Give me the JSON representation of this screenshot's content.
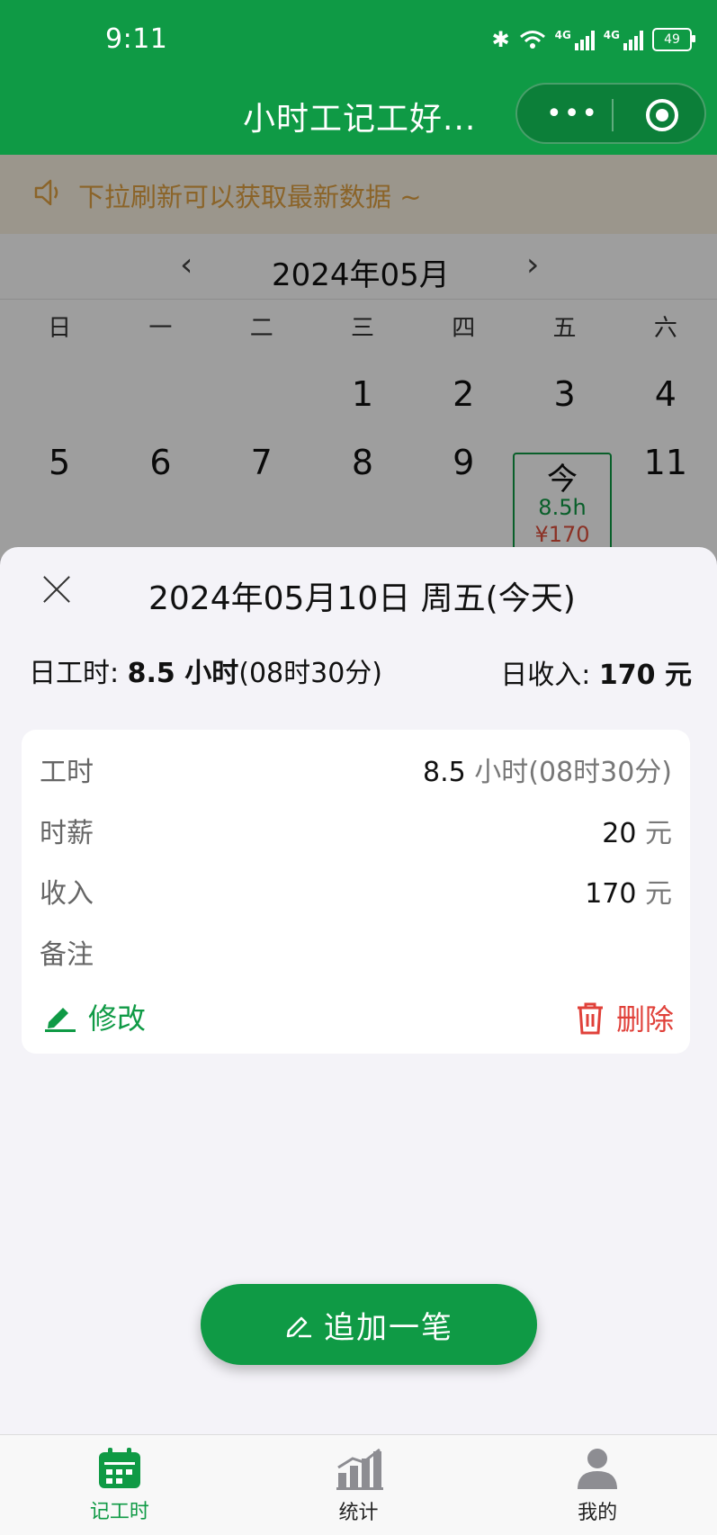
{
  "status_bar": {
    "time": "9:11",
    "network": "4G",
    "battery": "49"
  },
  "nav": {
    "title": "小时工记工好...",
    "more_label": "•••"
  },
  "notice": {
    "text": "下拉刷新可以获取最新数据 ~"
  },
  "calendar": {
    "month_title": "2024年05月",
    "prev_label": "‹",
    "next_label": "›",
    "weekdays": [
      "日",
      "一",
      "二",
      "三",
      "四",
      "五",
      "六"
    ],
    "week1": [
      "",
      "",
      "",
      "1",
      "2",
      "3",
      "4"
    ],
    "week2": [
      "5",
      "6",
      "7",
      "8",
      "9",
      "",
      "11"
    ],
    "today": {
      "label": "今",
      "hours": "8.5h",
      "amount": "¥170"
    }
  },
  "sheet": {
    "title": "2024年05月10日 周五(今天)",
    "day_hours_label": "日工时: ",
    "day_hours_value": "8.5 小时",
    "day_hours_detail": "(08时30分)",
    "day_income_label": "日收入: ",
    "day_income_value": "170 元"
  },
  "record": {
    "rows": [
      {
        "key": "工时",
        "value": "8.5",
        "unit": " 小时(08时30分)"
      },
      {
        "key": "时薪",
        "value": "20",
        "unit": " 元"
      },
      {
        "key": "收入",
        "value": "170",
        "unit": " 元"
      },
      {
        "key": "备注",
        "value": "",
        "unit": ""
      }
    ],
    "edit_label": "修改",
    "delete_label": "删除"
  },
  "add_button": {
    "label": "追加一笔"
  },
  "tabbar": {
    "items": [
      {
        "label": "记工时",
        "icon": "calendar-icon",
        "active": true
      },
      {
        "label": "统计",
        "icon": "chart-icon",
        "active": false
      },
      {
        "label": "我的",
        "icon": "user-icon",
        "active": false
      }
    ]
  },
  "colors": {
    "brand": "#0f9a45",
    "danger": "#e0413a",
    "notice": "#e0a243"
  }
}
